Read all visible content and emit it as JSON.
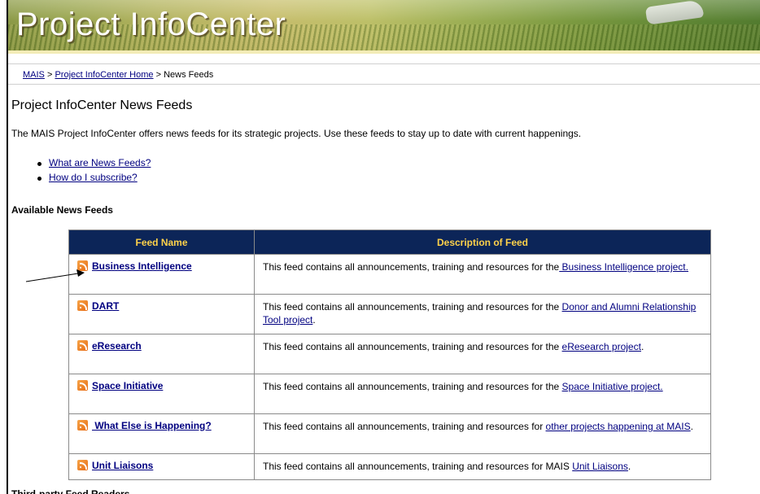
{
  "banner": {
    "title": "Project InfoCenter"
  },
  "breadcrumb": {
    "items": [
      {
        "label": "MAIS"
      },
      {
        "label": "Project InfoCenter Home"
      }
    ],
    "separator": ">",
    "current": "News Feeds"
  },
  "page": {
    "title": "Project InfoCenter News Feeds",
    "intro": "The MAIS Project InfoCenter offers news feeds for its strategic projects. Use these feeds to stay up to date with current happenings.",
    "links": [
      {
        "label": "What are News Feeds?"
      },
      {
        "label": "How do I subscribe?"
      }
    ],
    "section_heading": "Available News Feeds",
    "bottom_text": "Third-party Feed Readers"
  },
  "table": {
    "headers": {
      "name": "Feed Name",
      "description": "Description of Feed"
    },
    "rows": [
      {
        "name": "Business Intelligence",
        "prefix": "This feed contains all announcements, training and resources for the",
        "link": " Business Intelligence project.",
        "suffix": ""
      },
      {
        "name": "DART",
        "prefix": "This feed contains all announcements, training and resources for the ",
        "link": "Donor and Alumni Relationship Tool project",
        "suffix": "."
      },
      {
        "name": "eResearch",
        "prefix": "This feed contains all announcements, training and resources for the ",
        "link": "eResearch project",
        "suffix": "."
      },
      {
        "name": "Space Initiative",
        "prefix": "This feed contains all announcements, training and resources for the ",
        "link": "Space Initiative project.",
        "suffix": ""
      },
      {
        "name": " What Else is Happening?",
        "prefix": "This feed contains all announcements, training and resources for ",
        "link": "other projects happening at MAIS",
        "suffix": "."
      },
      {
        "name": "Unit Liaisons",
        "prefix": "This feed contains all announcements, training and resources for MAIS ",
        "link": "Unit Liaisons",
        "suffix": "."
      }
    ]
  },
  "icons": {
    "feed": "rss-icon",
    "pointer": "arrow-annotation"
  },
  "colors": {
    "header_bg": "#0c2558",
    "header_text": "#ffd24a",
    "link": "#000080"
  }
}
